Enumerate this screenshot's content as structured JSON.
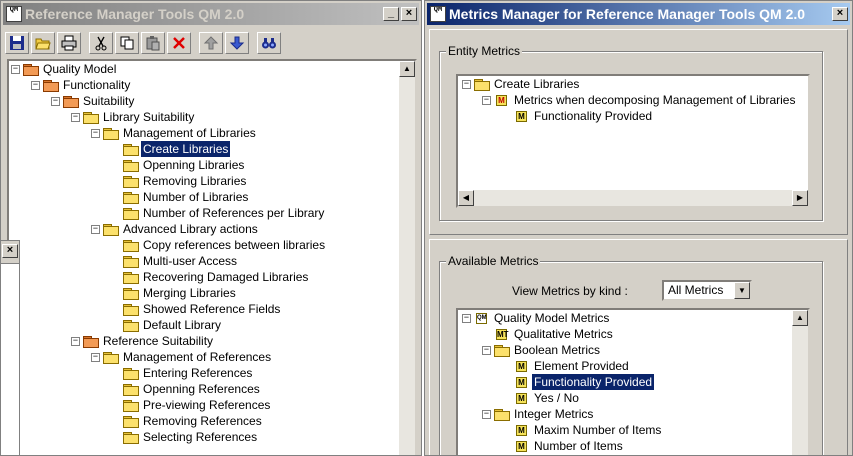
{
  "left_window": {
    "title": "Reference Manager Tools QM 2.0",
    "icon_text": "QM",
    "minimize_glyph": "_",
    "close_glyph": "×",
    "toolbar": [
      {
        "name": "save-button",
        "icon": "floppy-disk-icon"
      },
      {
        "name": "open-button",
        "icon": "open-folder-icon"
      },
      {
        "name": "print-button",
        "icon": "printer-icon"
      },
      {
        "name": "cut-button",
        "icon": "scissors-icon"
      },
      {
        "name": "copy-button",
        "icon": "copy-icon"
      },
      {
        "name": "paste-button",
        "icon": "clipboard-icon"
      },
      {
        "name": "delete-button",
        "icon": "red-x-icon"
      },
      {
        "name": "move-up-button",
        "icon": "up-arrow-icon"
      },
      {
        "name": "move-down-button",
        "icon": "down-arrow-icon"
      },
      {
        "name": "find-button",
        "icon": "binoculars-icon"
      }
    ],
    "tree": [
      {
        "label": "Quality Model",
        "level": 0,
        "expander": "−",
        "folder": "red"
      },
      {
        "label": "Functionality",
        "level": 1,
        "expander": "−",
        "folder": "red"
      },
      {
        "label": "Suitability",
        "level": 2,
        "expander": "−",
        "folder": "red"
      },
      {
        "label": "Library Suitability",
        "level": 3,
        "expander": "−",
        "folder": "yellow"
      },
      {
        "label": "Management of Libraries",
        "level": 4,
        "expander": "−",
        "folder": "yellow"
      },
      {
        "label": "Create Libraries",
        "level": 5,
        "folder": "yellow",
        "selected": true
      },
      {
        "label": "Openning Libraries",
        "level": 5,
        "folder": "yellow"
      },
      {
        "label": "Removing Libraries",
        "level": 5,
        "folder": "yellow"
      },
      {
        "label": "Number of Libraries",
        "level": 5,
        "folder": "yellow"
      },
      {
        "label": "Number of References per Library",
        "level": 5,
        "folder": "yellow"
      },
      {
        "label": "Advanced Library actions",
        "level": 4,
        "expander": "−",
        "folder": "yellow"
      },
      {
        "label": "Copy references between libraries",
        "level": 5,
        "folder": "yellow"
      },
      {
        "label": "Multi-user Access",
        "level": 5,
        "folder": "yellow"
      },
      {
        "label": "Recovering Damaged Libraries",
        "level": 5,
        "folder": "yellow"
      },
      {
        "label": "Merging Libraries",
        "level": 5,
        "folder": "yellow"
      },
      {
        "label": "Showed Reference Fields",
        "level": 5,
        "folder": "yellow"
      },
      {
        "label": "Default Library",
        "level": 5,
        "folder": "yellow"
      },
      {
        "label": "Reference Suitability",
        "level": 3,
        "expander": "−",
        "folder": "red"
      },
      {
        "label": "Management of References",
        "level": 4,
        "expander": "−",
        "folder": "yellow"
      },
      {
        "label": "Entering References",
        "level": 5,
        "folder": "yellow"
      },
      {
        "label": "Openning References",
        "level": 5,
        "folder": "yellow"
      },
      {
        "label": "Pre-viewing References",
        "level": 5,
        "folder": "yellow"
      },
      {
        "label": "Removing References",
        "level": 5,
        "folder": "yellow"
      },
      {
        "label": "Selecting References",
        "level": 5,
        "folder": "yellow"
      }
    ]
  },
  "side_panel": {
    "close_glyph": "×"
  },
  "right_window": {
    "title": "Metrics Manager for Reference Manager Tools QM 2.0",
    "icon_text": "QM",
    "close_glyph": "×",
    "entity_metrics": {
      "label": "Entity Metrics",
      "tree": [
        {
          "label": "Create Libraries",
          "level": 0,
          "expander": "−",
          "kind": "folder"
        },
        {
          "label": "Metrics when decomposing Management of Libraries",
          "level": 1,
          "expander": "−",
          "kind": "badge-red",
          "badge": "M"
        },
        {
          "label": "Functionality Provided",
          "level": 2,
          "kind": "badge",
          "badge": "M"
        }
      ]
    },
    "available_metrics": {
      "label": "Available Metrics",
      "filter_label": "View Metrics by kind :",
      "filter_value": "All Metrics",
      "tree": [
        {
          "label": "Quality Model Metrics",
          "level": 0,
          "expander": "−",
          "kind": "badge-qm",
          "badge": "QM"
        },
        {
          "label": "Qualitative Metrics",
          "level": 1,
          "kind": "badge",
          "badge": "MT"
        },
        {
          "label": "Boolean Metrics",
          "level": 1,
          "expander": "−",
          "kind": "folder"
        },
        {
          "label": "Element Provided",
          "level": 2,
          "kind": "badge",
          "badge": "M"
        },
        {
          "label": "Functionality Provided",
          "level": 2,
          "kind": "badge",
          "badge": "M",
          "selected": true
        },
        {
          "label": "Yes / No",
          "level": 2,
          "kind": "badge",
          "badge": "M"
        },
        {
          "label": "Integer Metrics",
          "level": 1,
          "expander": "−",
          "kind": "folder"
        },
        {
          "label": "Maxim Number of Items",
          "level": 2,
          "kind": "badge",
          "badge": "M"
        },
        {
          "label": "Number of Items",
          "level": 2,
          "kind": "badge",
          "badge": "M"
        }
      ]
    }
  },
  "scroll_glyphs": {
    "up": "▲",
    "down": "▼",
    "left": "◀",
    "right": "▶"
  }
}
